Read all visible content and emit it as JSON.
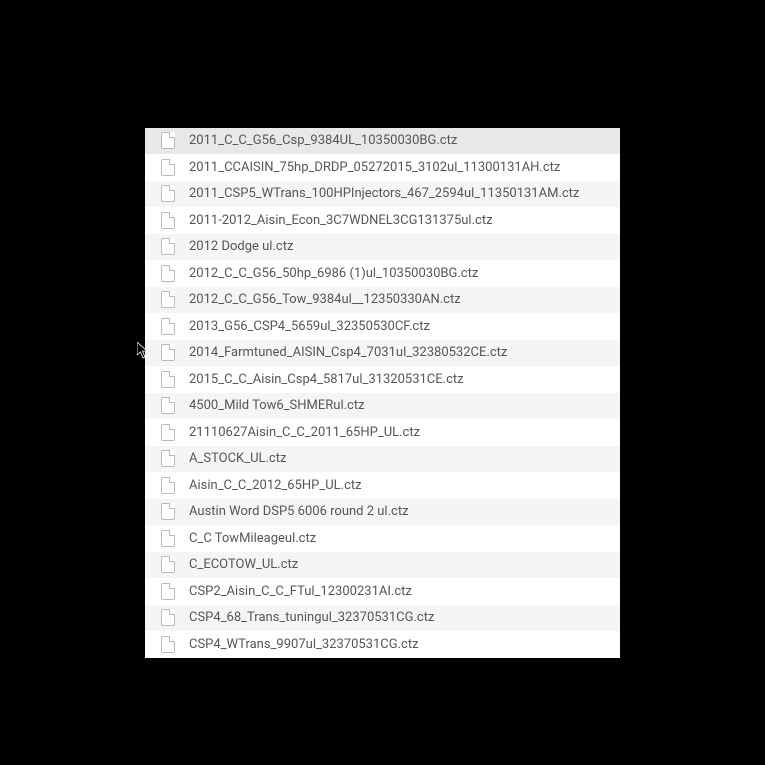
{
  "fileList": {
    "files": [
      {
        "name": "2011_C_C_G56_Csp_9384UL_10350030BG.ctz",
        "selected": true
      },
      {
        "name": "2011_CCAISIN_75hp_DRDP_05272015_3102ul_11300131AH.ctz",
        "selected": false
      },
      {
        "name": "2011_CSP5_WTrans_100HPInjectors_467_2594ul_11350131AM.ctz",
        "selected": false
      },
      {
        "name": "2011-2012_Aisin_Econ_3C7WDNEL3CG131375ul.ctz",
        "selected": false
      },
      {
        "name": "2012 Dodge ul.ctz",
        "selected": false
      },
      {
        "name": "2012_C_C_G56_50hp_6986 (1)ul_10350030BG.ctz",
        "selected": false
      },
      {
        "name": "2012_C_C_G56_Tow_9384ul__12350330AN.ctz",
        "selected": false
      },
      {
        "name": "2013_G56_CSP4_5659ul_32350530CF.ctz",
        "selected": false
      },
      {
        "name": "2014_Farmtuned_AISIN_Csp4_7031ul_32380532CE.ctz",
        "selected": false
      },
      {
        "name": "2015_C_C_Aisin_Csp4_5817ul_31320531CE.ctz",
        "selected": false
      },
      {
        "name": "4500_Mild Tow6_SHMERul.ctz",
        "selected": false
      },
      {
        "name": "21110627Aisin_C_C_2011_65HP_UL.ctz",
        "selected": false
      },
      {
        "name": "A_STOCK_UL.ctz",
        "selected": false
      },
      {
        "name": "Aisin_C_C_2012_65HP_UL.ctz",
        "selected": false
      },
      {
        "name": "Austin Word DSP5 6006 round 2 ul.ctz",
        "selected": false
      },
      {
        "name": "C_C TowMileageul.ctz",
        "selected": false
      },
      {
        "name": "C_ECOTOW_UL.ctz",
        "selected": false
      },
      {
        "name": "CSP2_Aisin_C_C_FTul_12300231AI.ctz",
        "selected": false
      },
      {
        "name": "CSP4_68_Trans_tuningul_32370531CG.ctz",
        "selected": false
      },
      {
        "name": "CSP4_WTrans_9907ul_32370531CG.ctz",
        "selected": false
      }
    ]
  }
}
